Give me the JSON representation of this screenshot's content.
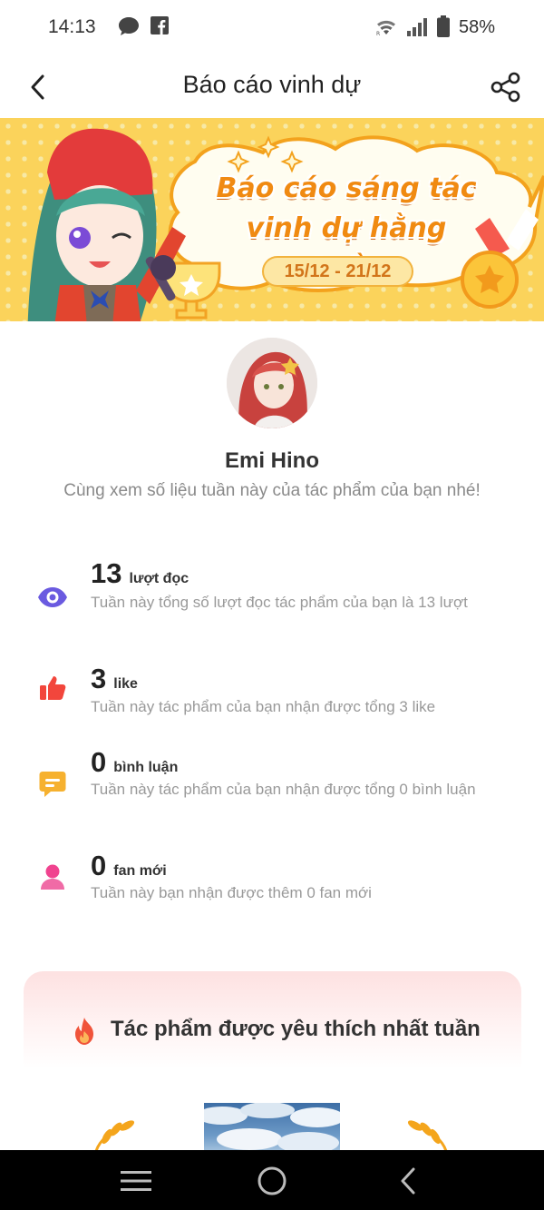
{
  "status_bar": {
    "time": "14:13",
    "battery": "58%",
    "icons": [
      "message-icon",
      "facebook-icon",
      "wifi-icon",
      "signal-icon",
      "battery-icon"
    ]
  },
  "header": {
    "title": "Báo cáo vinh dự",
    "back_icon": "back-arrow-icon",
    "share_icon": "share-icon"
  },
  "banner": {
    "title_line1": "Báo cáo sáng tác",
    "title_line2": "vinh dự hằng tuần",
    "date_range": "15/12 - 21/12"
  },
  "profile": {
    "name": "Emi Hino",
    "subtitle": "Cùng xem số liệu tuần này của tác phẩm của bạn nhé!"
  },
  "stats": [
    {
      "icon": "eye-icon",
      "color": "#6a5ae0",
      "value": "13",
      "unit": "lượt đọc",
      "description": "Tuần này tổng số lượt đọc tác phẩm của bạn là 13 lượt"
    },
    {
      "icon": "thumbs-up-icon",
      "color": "#f2463c",
      "value": "3",
      "unit": "like",
      "description": "Tuần này tác phẩm của bạn nhận được tổng 3 like"
    },
    {
      "icon": "comment-icon",
      "color": "#f6b12f",
      "value": "0",
      "unit": "bình luận",
      "description": "Tuần này tác phẩm của bạn nhận được tổng 0 bình luận"
    },
    {
      "icon": "user-icon",
      "color": "#f0438f",
      "value": "0",
      "unit": "fan mới",
      "description": "Tuần này bạn nhận được thêm 0 fan mới"
    }
  ],
  "favorite": {
    "title": "Tác phẩm được yêu thích nhất tuần",
    "icon": "flame-icon"
  },
  "nav_bar": {
    "icons": [
      "recent-apps-icon",
      "home-icon",
      "back-icon"
    ]
  }
}
